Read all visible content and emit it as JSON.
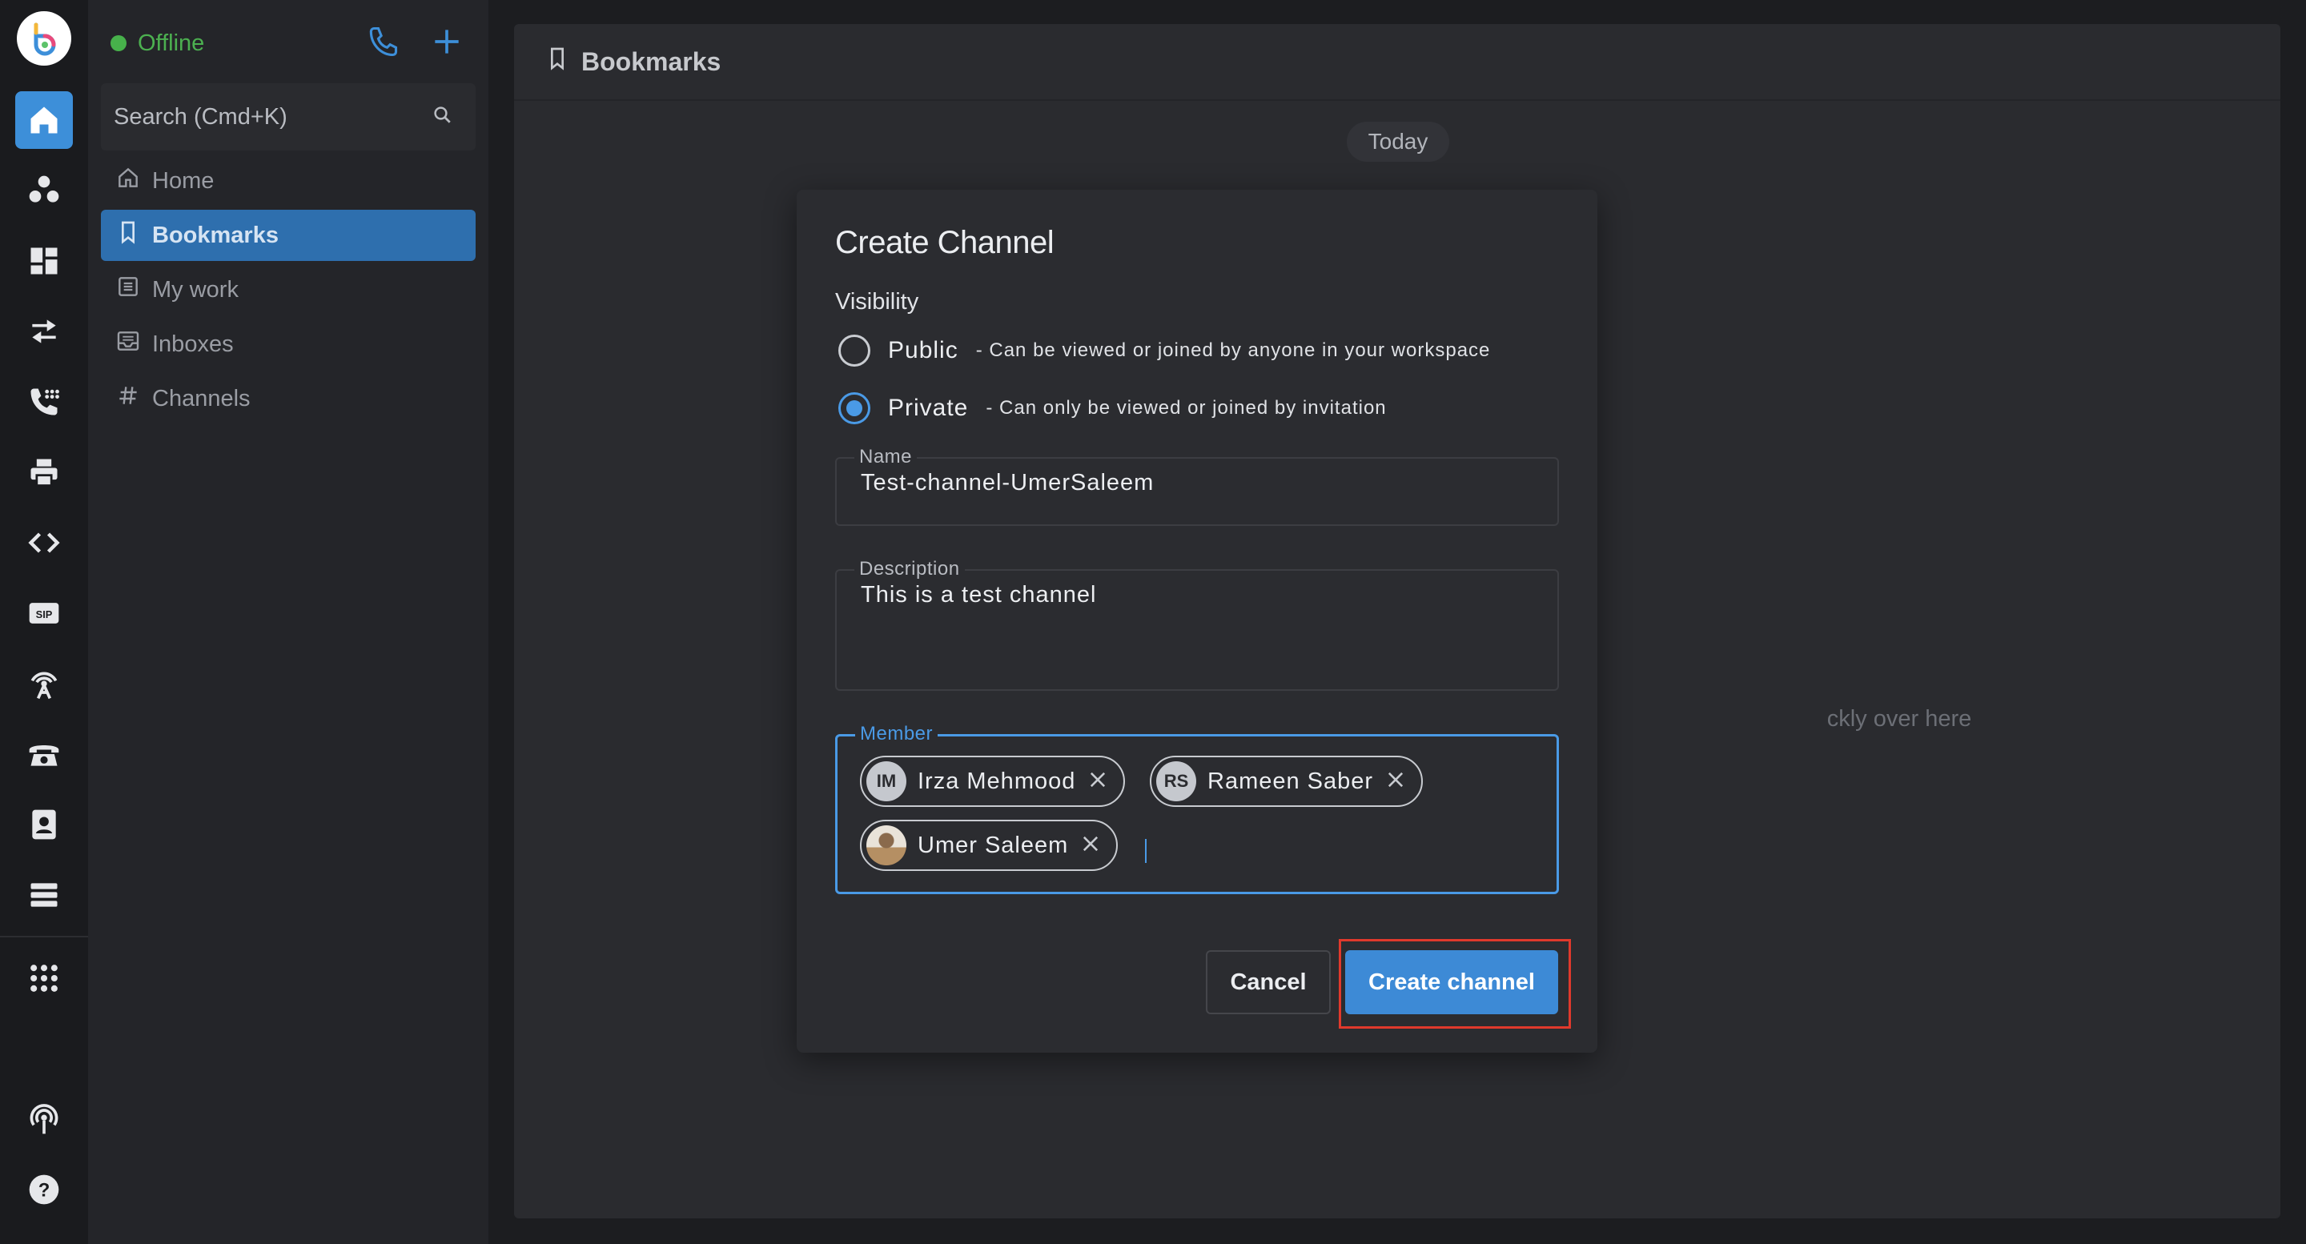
{
  "sidebar": {
    "status": "Offline",
    "search_placeholder": "Search (Cmd+K)",
    "items": [
      {
        "label": "Home"
      },
      {
        "label": "Bookmarks"
      },
      {
        "label": "My work"
      },
      {
        "label": "Inboxes"
      },
      {
        "label": "Channels"
      }
    ]
  },
  "rail": {
    "icons": [
      "logo-icon",
      "home-icon",
      "people-icon",
      "dashboard-icon",
      "transfer-icon",
      "phone-dialpad-icon",
      "printer-icon",
      "code-icon",
      "sip-icon",
      "antenna-icon",
      "desk-phone-icon",
      "contact-card-icon",
      "server-icon",
      "apps-grid-icon",
      "podcast-icon",
      "help-icon"
    ]
  },
  "main": {
    "title": "Bookmarks",
    "date_pill": "Today",
    "empty_hint": "ckly over here"
  },
  "modal": {
    "title": "Create Channel",
    "visibility_label": "Visibility",
    "public": {
      "label": "Public",
      "desc": "- Can be viewed or joined by anyone in your workspace",
      "selected": false
    },
    "private": {
      "label": "Private",
      "desc": "- Can only be viewed or joined by invitation",
      "selected": true
    },
    "name_field": {
      "label": "Name",
      "value": "Test-channel-UmerSaleem"
    },
    "description_field": {
      "label": "Description",
      "value": "This is a test channel"
    },
    "member_field": {
      "label": "Member",
      "members": [
        {
          "initials": "IM",
          "name": "Irza Mehmood"
        },
        {
          "initials": "RS",
          "name": "Rameen Saber"
        },
        {
          "initials": "",
          "name": "Umer Saleem"
        }
      ]
    },
    "cancel_label": "Cancel",
    "create_label": "Create channel"
  },
  "colors": {
    "accent": "#3d8fd9",
    "online": "#47b14b",
    "highlight": "#e0392c"
  }
}
